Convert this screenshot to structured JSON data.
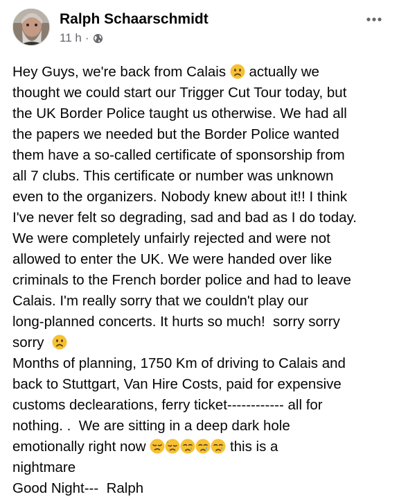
{
  "post": {
    "author": "Ralph Schaarschmidt",
    "timestamp": "11 h",
    "separator": "·",
    "privacy_icon": "globe-icon",
    "more_icon": "more-horizontal-icon",
    "body_lines": [
      {
        "pre": "Hey Guys, we're back from Calais ",
        "emoji": [
          "frowning-face"
        ],
        "post": " actually we"
      },
      {
        "pre": "thought we could start our Trigger Cut Tour today, but",
        "emoji": [],
        "post": ""
      },
      {
        "pre": "the UK Border Police taught us otherwise. We had all",
        "emoji": [],
        "post": ""
      },
      {
        "pre": "the papers we needed but the Border Police wanted",
        "emoji": [],
        "post": ""
      },
      {
        "pre": "them have a so-called certificate of sponsorship from",
        "emoji": [],
        "post": ""
      },
      {
        "pre": "all 7 clubs. This certificate or number was unknown",
        "emoji": [],
        "post": ""
      },
      {
        "pre": "even to the organizers. Nobody knew about it!! I think",
        "emoji": [],
        "post": ""
      },
      {
        "pre": "I've never felt so degrading, sad and bad as I do today.",
        "emoji": [],
        "post": ""
      },
      {
        "pre": "We were completely unfairly rejected and were not",
        "emoji": [],
        "post": ""
      },
      {
        "pre": "allowed to enter the UK. We were handed over like",
        "emoji": [],
        "post": ""
      },
      {
        "pre": "criminals to the French border police and had to leave",
        "emoji": [],
        "post": ""
      },
      {
        "pre": "Calais. I'm really sorry that we couldn't play our",
        "emoji": [],
        "post": ""
      },
      {
        "pre": "long-planned concerts. It hurts so much!  sorry sorry",
        "emoji": [],
        "post": ""
      },
      {
        "pre": "sorry  ",
        "emoji": [
          "frowning-face"
        ],
        "post": ""
      },
      {
        "pre": "Months of planning, 1750 Km of driving to Calais and",
        "emoji": [],
        "post": ""
      },
      {
        "pre": "back to Stuttgart, Van Hire Costs, paid for expensive",
        "emoji": [],
        "post": ""
      },
      {
        "pre": "customs declearations, ferry ticket------------ all for",
        "emoji": [],
        "post": ""
      },
      {
        "pre": "nothing. .  We are sitting in a deep dark hole",
        "emoji": [],
        "post": ""
      },
      {
        "pre": "emotionally right now ",
        "emoji": [
          "disappointed-face",
          "downcast-sweat-face",
          "crying-face",
          "crying-face",
          "crying-face"
        ],
        "post": " this is a"
      },
      {
        "pre": "nightmare",
        "emoji": [],
        "post": ""
      },
      {
        "pre": "Good Night---  Ralph",
        "emoji": [],
        "post": ""
      }
    ]
  },
  "colors": {
    "text": "#050505",
    "meta": "#65676b",
    "emoji_yellow": "#f6c132",
    "tear_blue": "#5aa9e6"
  }
}
